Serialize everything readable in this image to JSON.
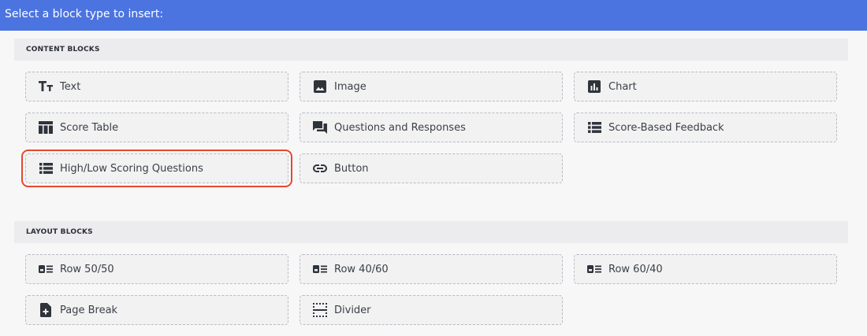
{
  "header": {
    "title": "Select a block type to insert:"
  },
  "content_section": {
    "title": "CONTENT BLOCKS",
    "blocks": [
      {
        "label": "Text",
        "icon": "text-icon"
      },
      {
        "label": "Image",
        "icon": "image-icon"
      },
      {
        "label": "Chart",
        "icon": "chart-icon"
      },
      {
        "label": "Score Table",
        "icon": "table-icon"
      },
      {
        "label": "Questions and Responses",
        "icon": "chat-icon"
      },
      {
        "label": "Score-Based Feedback",
        "icon": "list-icon"
      },
      {
        "label": "High/Low Scoring Questions",
        "icon": "list-icon"
      },
      {
        "label": "Button",
        "icon": "link-icon"
      }
    ]
  },
  "layout_section": {
    "title": "LAYOUT BLOCKS",
    "blocks": [
      {
        "label": "Row 50/50",
        "icon": "row-icon"
      },
      {
        "label": "Row 40/60",
        "icon": "row-icon"
      },
      {
        "label": "Row 60/40",
        "icon": "row-icon"
      },
      {
        "label": "Page Break",
        "icon": "page-break-icon"
      },
      {
        "label": "Divider",
        "icon": "divider-icon"
      }
    ]
  },
  "colors": {
    "header_bg": "#4b74e0",
    "highlight": "#e8472d",
    "icon": "#2f343b"
  }
}
